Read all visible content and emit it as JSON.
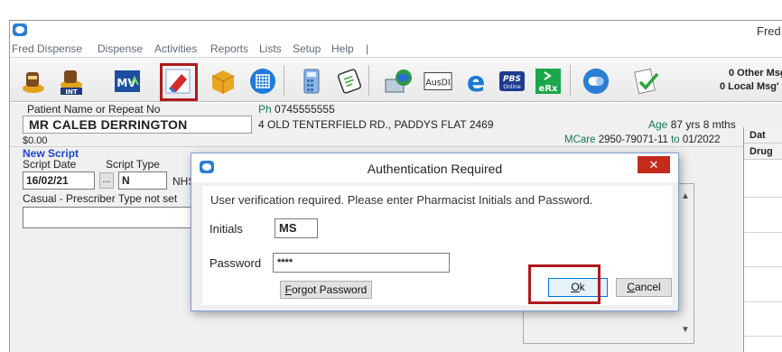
{
  "window": {
    "title": "Fred"
  },
  "menu": [
    "Fred Dispense",
    "Dispense",
    "Activities",
    "Reports",
    "Lists",
    "Setup",
    "Help",
    "|"
  ],
  "toolbar": {
    "int_label": "INT",
    "mv_label": "MV",
    "ausdi_label": "AusDI",
    "pbs_label": "PBS",
    "pbs_sub": "Online",
    "erx_label": "eRx",
    "other_msgs": "0 Other Msg'",
    "local_msgs": "0 Local Msg'"
  },
  "patient": {
    "name_label": "Patient Name or Repeat No",
    "name": "MR CALEB DERRINGTON",
    "balance": "$0.00",
    "phone_prefix": "Ph",
    "phone": "0745555555",
    "address": "4 OLD TENTERFIELD RD., PADDYS FLAT 2469",
    "age_label": "Age",
    "age": "87 yrs 8 mths",
    "medicare_label": "MCare",
    "medicare": "2950-79071-11",
    "to_label": "to",
    "expiry": "01/2022"
  },
  "script": {
    "heading": "New Script",
    "date_label": "Script Date",
    "type_label": "Script Type",
    "date": "16/02/21",
    "browse": "...",
    "type": "N",
    "nhs": "NHS",
    "prescriber": "Casual - Prescriber Type not set"
  },
  "grid": {
    "col1": "Dat",
    "col2": "Drug"
  },
  "dialog": {
    "title": "Authentication Required",
    "close": "✕",
    "message": "User verification required. Please enter Pharmacist Initials and Password.",
    "initials_label": "Initials",
    "initials": "MS",
    "password_label": "Password",
    "password": "****",
    "forgot_first": "F",
    "forgot_rest": "orgot Password",
    "ok_first": "O",
    "ok_rest": "k",
    "cancel_first": "C",
    "cancel_rest": "ancel"
  },
  "colors": {
    "highlight": "#b0191c",
    "link_blue": "#1a49c9",
    "close_red": "#c42b1c",
    "teal_text": "#0f7a5a"
  }
}
